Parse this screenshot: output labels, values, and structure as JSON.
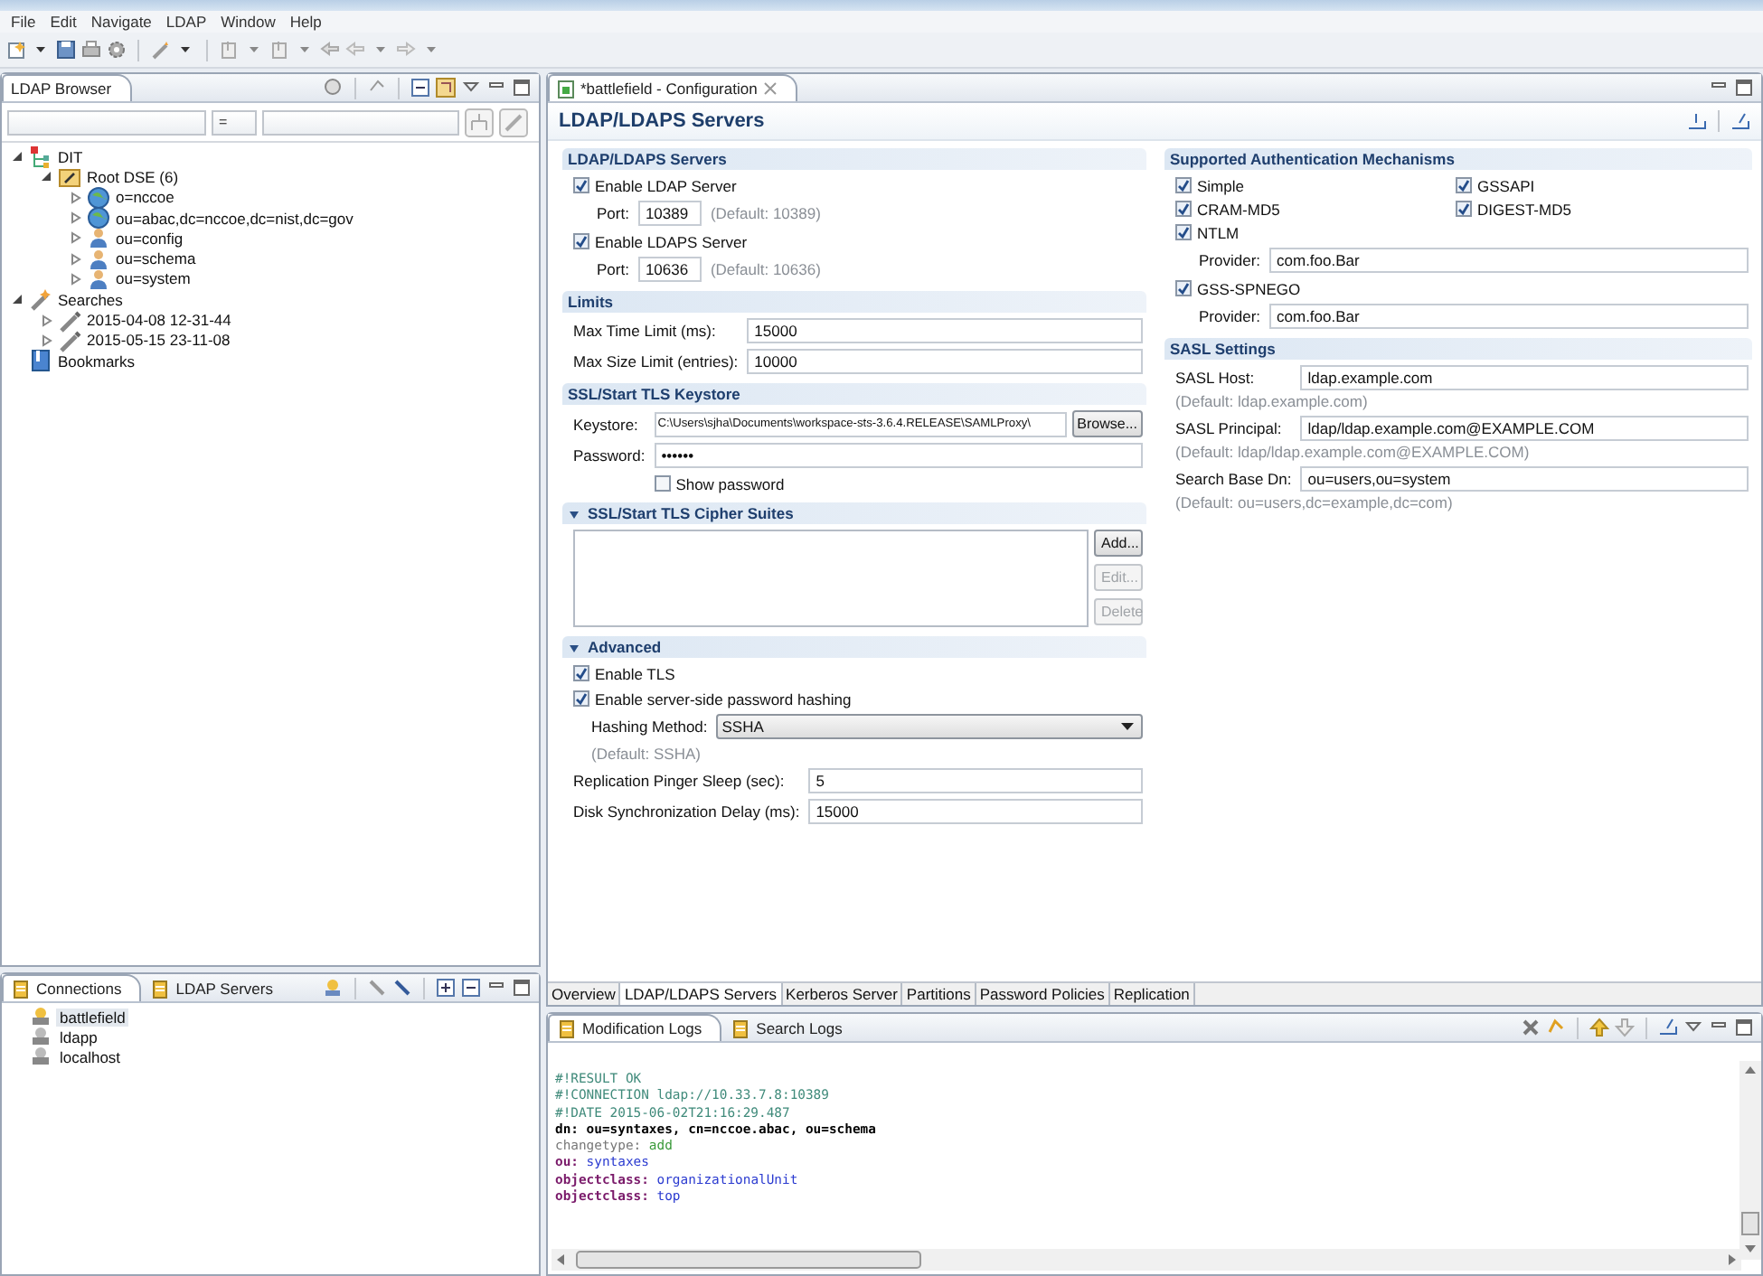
{
  "menu": [
    "File",
    "Edit",
    "Navigate",
    "LDAP",
    "Window",
    "Help"
  ],
  "ldap_browser": {
    "tab": "LDAP Browser",
    "filter_operator": "=",
    "tree": [
      {
        "label": "DIT",
        "kind": "dit",
        "expanded": true,
        "children": [
          {
            "label": "Root DSE (6)",
            "kind": "root",
            "expanded": true,
            "children": [
              {
                "label": "o=nccoe",
                "kind": "globe",
                "expanded": false
              },
              {
                "label": "ou=abac,dc=nccoe,dc=nist,dc=gov",
                "kind": "globe",
                "expanded": false
              },
              {
                "label": "ou=config",
                "kind": "people",
                "expanded": false
              },
              {
                "label": "ou=schema",
                "kind": "people",
                "expanded": false
              },
              {
                "label": "ou=system",
                "kind": "people",
                "expanded": false
              }
            ]
          }
        ]
      },
      {
        "label": "Searches",
        "kind": "searches",
        "expanded": true,
        "children": [
          {
            "label": "2015-04-08 12-31-44",
            "kind": "search",
            "expanded": false
          },
          {
            "label": "2015-05-15 23-11-08",
            "kind": "search",
            "expanded": false
          }
        ]
      },
      {
        "label": "Bookmarks",
        "kind": "bookmarks"
      }
    ]
  },
  "connections_panel": {
    "tabs": [
      {
        "label": "Connections",
        "selected": true
      },
      {
        "label": "LDAP Servers",
        "selected": false
      }
    ],
    "connections": [
      {
        "name": "battlefield",
        "selected": true
      },
      {
        "name": "ldapp",
        "selected": false
      },
      {
        "name": "localhost",
        "selected": false
      }
    ]
  },
  "editor": {
    "tab": "*battlefield - Configuration",
    "title": "LDAP/LDAPS Servers",
    "left_sections": [
      {
        "title": "LDAP/LDAPS Servers",
        "rows": [
          {
            "kind": "checkbox",
            "label": "Enable LDAP Server",
            "checked": true
          },
          {
            "kind": "port",
            "label": "Port:",
            "value": "10389",
            "hint": "(Default: 10389)"
          },
          {
            "kind": "checkbox",
            "label": "Enable LDAPS Server",
            "checked": true
          },
          {
            "kind": "port",
            "label": "Port:",
            "value": "10636",
            "hint": "(Default: 10636)"
          }
        ]
      },
      {
        "title": "Limits",
        "rows": [
          {
            "kind": "field",
            "label": "Max Time Limit (ms):",
            "value": "15000"
          },
          {
            "kind": "field",
            "label": "Max Size Limit (entries):",
            "value": "10000"
          }
        ]
      },
      {
        "title": "SSL/Start TLS Keystore",
        "rows": [
          {
            "kind": "browse",
            "label": "Keystore:",
            "value": "C:\\Users\\sjha\\Documents\\workspace-sts-3.6.4.RELEASE\\SAMLProxy\\",
            "button": "Browse..."
          },
          {
            "kind": "password",
            "label": "Password:",
            "value": "••••••",
            "show_password": {
              "label": "Show password",
              "checked": false
            }
          }
        ]
      },
      {
        "title": "SSL/Start TLS Cipher Suites",
        "expanded": true,
        "rows": [
          {
            "kind": "list",
            "buttons": [
              {
                "label": "Add...",
                "disabled": false
              },
              {
                "label": "Edit...",
                "disabled": true
              },
              {
                "label": "Delete",
                "disabled": true
              }
            ]
          }
        ]
      },
      {
        "title": "Advanced",
        "expanded": true,
        "rows": [
          {
            "kind": "checkbox",
            "label": "Enable TLS",
            "checked": true
          },
          {
            "kind": "checkbox",
            "label": "Enable server-side password hashing",
            "checked": true
          },
          {
            "kind": "select",
            "label": "Hashing Method:",
            "value": "SSHA",
            "hint": "(Default: SSHA)"
          },
          {
            "kind": "field",
            "label": "Replication Pinger Sleep (sec):",
            "value": "5"
          },
          {
            "kind": "field",
            "label": "Disk Synchronization Delay (ms):",
            "value": "15000"
          }
        ]
      }
    ],
    "right_sections": [
      {
        "title": "Supported Authentication Mechanisms",
        "rows": [
          {
            "kind": "checkgrid",
            "items": [
              {
                "label": "Simple",
                "checked": true
              },
              {
                "label": "GSSAPI",
                "checked": true
              },
              {
                "label": "CRAM-MD5",
                "checked": true
              },
              {
                "label": "DIGEST-MD5",
                "checked": true
              },
              {
                "label": "NTLM",
                "checked": true
              }
            ]
          },
          {
            "kind": "provider",
            "label": "Provider:",
            "value": "com.foo.Bar"
          },
          {
            "kind": "checkbox",
            "label": "GSS-SPNEGO",
            "checked": true
          },
          {
            "kind": "provider",
            "label": "Provider:",
            "value": "com.foo.Bar"
          }
        ]
      },
      {
        "title": "SASL Settings",
        "rows": [
          {
            "kind": "field",
            "label": "SASL Host:",
            "value": "ldap.example.com"
          },
          {
            "kind": "hint",
            "text": "(Default: ldap.example.com)"
          },
          {
            "kind": "field",
            "label": "SASL Principal:",
            "value": "ldap/ldap.example.com@EXAMPLE.COM"
          },
          {
            "kind": "hint",
            "text": "(Default: ldap/ldap.example.com@EXAMPLE.COM)"
          },
          {
            "kind": "field",
            "label": "Search Base Dn:",
            "value": "ou=users,ou=system"
          },
          {
            "kind": "hint",
            "text": "(Default: ou=users,dc=example,dc=com)"
          }
        ]
      }
    ],
    "page_tabs": [
      {
        "label": "Overview",
        "selected": false
      },
      {
        "label": "LDAP/LDAPS Servers",
        "selected": true
      },
      {
        "label": "Kerberos Server",
        "selected": false
      },
      {
        "label": "Partitions",
        "selected": false
      },
      {
        "label": "Password Policies",
        "selected": false
      },
      {
        "label": "Replication",
        "selected": false
      }
    ]
  },
  "logs_panel": {
    "tabs": [
      {
        "label": "Modification Logs",
        "selected": true
      },
      {
        "label": "Search Logs",
        "selected": false
      }
    ],
    "lines": [
      {
        "kind": "comment",
        "text": "#!RESULT OK"
      },
      {
        "kind": "comment",
        "text": "#!CONNECTION ldap://10.33.7.8:10389"
      },
      {
        "kind": "comment",
        "text": "#!DATE 2015-06-02T21:16:29.487"
      },
      {
        "kind": "dn",
        "key": "dn:",
        "value": " ou=syntaxes, cn=nccoe.abac, ou=schema"
      },
      {
        "kind": "changetype",
        "key": "changetype:",
        "value": " add"
      },
      {
        "kind": "attribute",
        "key": "ou:",
        "value": " syntaxes"
      },
      {
        "kind": "attribute",
        "key": "objectclass:",
        "value": " organizationalUnit"
      },
      {
        "kind": "attribute",
        "key": "objectclass:",
        "value": " top"
      }
    ]
  }
}
